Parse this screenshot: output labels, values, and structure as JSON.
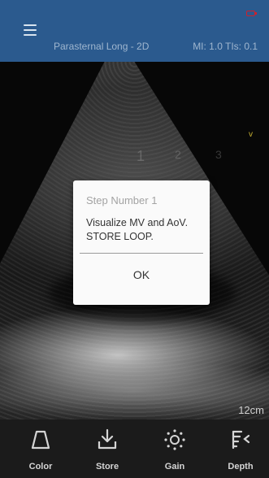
{
  "header": {
    "mode": "Parasternal Long - 2D",
    "index": "MI: 1.0 TIs: 0.1"
  },
  "scan": {
    "markers": [
      "1",
      "2",
      "3"
    ],
    "orientation": "v",
    "depth": "12cm"
  },
  "dialog": {
    "title": "Step Number 1",
    "body": "Visualize MV and AoV. STORE LOOP.",
    "ok_label": "OK"
  },
  "toolbar": {
    "items": [
      {
        "label": "Color",
        "icon": "color-probe-icon"
      },
      {
        "label": "Store",
        "icon": "download-icon"
      },
      {
        "label": "Gain",
        "icon": "sun-icon"
      },
      {
        "label": "Depth",
        "icon": "depth-icon"
      }
    ]
  },
  "colors": {
    "header": "#2b5a8e",
    "toolbar": "#1b1b1b",
    "dialog": "#fafafa",
    "battery": "#d0202a"
  }
}
